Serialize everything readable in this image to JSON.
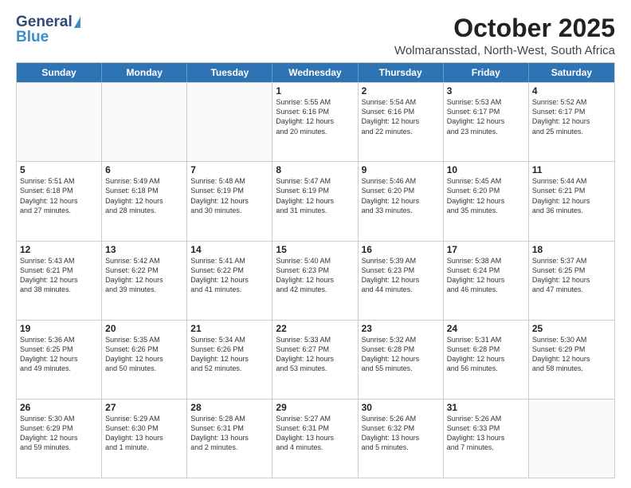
{
  "logo": {
    "line1": "General",
    "line2": "Blue"
  },
  "title": "October 2025",
  "location": "Wolmaransstad, North-West, South Africa",
  "weekdays": [
    "Sunday",
    "Monday",
    "Tuesday",
    "Wednesday",
    "Thursday",
    "Friday",
    "Saturday"
  ],
  "weeks": [
    [
      {
        "day": "",
        "info": ""
      },
      {
        "day": "",
        "info": ""
      },
      {
        "day": "",
        "info": ""
      },
      {
        "day": "1",
        "info": "Sunrise: 5:55 AM\nSunset: 6:16 PM\nDaylight: 12 hours\nand 20 minutes."
      },
      {
        "day": "2",
        "info": "Sunrise: 5:54 AM\nSunset: 6:16 PM\nDaylight: 12 hours\nand 22 minutes."
      },
      {
        "day": "3",
        "info": "Sunrise: 5:53 AM\nSunset: 6:17 PM\nDaylight: 12 hours\nand 23 minutes."
      },
      {
        "day": "4",
        "info": "Sunrise: 5:52 AM\nSunset: 6:17 PM\nDaylight: 12 hours\nand 25 minutes."
      }
    ],
    [
      {
        "day": "5",
        "info": "Sunrise: 5:51 AM\nSunset: 6:18 PM\nDaylight: 12 hours\nand 27 minutes."
      },
      {
        "day": "6",
        "info": "Sunrise: 5:49 AM\nSunset: 6:18 PM\nDaylight: 12 hours\nand 28 minutes."
      },
      {
        "day": "7",
        "info": "Sunrise: 5:48 AM\nSunset: 6:19 PM\nDaylight: 12 hours\nand 30 minutes."
      },
      {
        "day": "8",
        "info": "Sunrise: 5:47 AM\nSunset: 6:19 PM\nDaylight: 12 hours\nand 31 minutes."
      },
      {
        "day": "9",
        "info": "Sunrise: 5:46 AM\nSunset: 6:20 PM\nDaylight: 12 hours\nand 33 minutes."
      },
      {
        "day": "10",
        "info": "Sunrise: 5:45 AM\nSunset: 6:20 PM\nDaylight: 12 hours\nand 35 minutes."
      },
      {
        "day": "11",
        "info": "Sunrise: 5:44 AM\nSunset: 6:21 PM\nDaylight: 12 hours\nand 36 minutes."
      }
    ],
    [
      {
        "day": "12",
        "info": "Sunrise: 5:43 AM\nSunset: 6:21 PM\nDaylight: 12 hours\nand 38 minutes."
      },
      {
        "day": "13",
        "info": "Sunrise: 5:42 AM\nSunset: 6:22 PM\nDaylight: 12 hours\nand 39 minutes."
      },
      {
        "day": "14",
        "info": "Sunrise: 5:41 AM\nSunset: 6:22 PM\nDaylight: 12 hours\nand 41 minutes."
      },
      {
        "day": "15",
        "info": "Sunrise: 5:40 AM\nSunset: 6:23 PM\nDaylight: 12 hours\nand 42 minutes."
      },
      {
        "day": "16",
        "info": "Sunrise: 5:39 AM\nSunset: 6:23 PM\nDaylight: 12 hours\nand 44 minutes."
      },
      {
        "day": "17",
        "info": "Sunrise: 5:38 AM\nSunset: 6:24 PM\nDaylight: 12 hours\nand 46 minutes."
      },
      {
        "day": "18",
        "info": "Sunrise: 5:37 AM\nSunset: 6:25 PM\nDaylight: 12 hours\nand 47 minutes."
      }
    ],
    [
      {
        "day": "19",
        "info": "Sunrise: 5:36 AM\nSunset: 6:25 PM\nDaylight: 12 hours\nand 49 minutes."
      },
      {
        "day": "20",
        "info": "Sunrise: 5:35 AM\nSunset: 6:26 PM\nDaylight: 12 hours\nand 50 minutes."
      },
      {
        "day": "21",
        "info": "Sunrise: 5:34 AM\nSunset: 6:26 PM\nDaylight: 12 hours\nand 52 minutes."
      },
      {
        "day": "22",
        "info": "Sunrise: 5:33 AM\nSunset: 6:27 PM\nDaylight: 12 hours\nand 53 minutes."
      },
      {
        "day": "23",
        "info": "Sunrise: 5:32 AM\nSunset: 6:28 PM\nDaylight: 12 hours\nand 55 minutes."
      },
      {
        "day": "24",
        "info": "Sunrise: 5:31 AM\nSunset: 6:28 PM\nDaylight: 12 hours\nand 56 minutes."
      },
      {
        "day": "25",
        "info": "Sunrise: 5:30 AM\nSunset: 6:29 PM\nDaylight: 12 hours\nand 58 minutes."
      }
    ],
    [
      {
        "day": "26",
        "info": "Sunrise: 5:30 AM\nSunset: 6:29 PM\nDaylight: 12 hours\nand 59 minutes."
      },
      {
        "day": "27",
        "info": "Sunrise: 5:29 AM\nSunset: 6:30 PM\nDaylight: 13 hours\nand 1 minute."
      },
      {
        "day": "28",
        "info": "Sunrise: 5:28 AM\nSunset: 6:31 PM\nDaylight: 13 hours\nand 2 minutes."
      },
      {
        "day": "29",
        "info": "Sunrise: 5:27 AM\nSunset: 6:31 PM\nDaylight: 13 hours\nand 4 minutes."
      },
      {
        "day": "30",
        "info": "Sunrise: 5:26 AM\nSunset: 6:32 PM\nDaylight: 13 hours\nand 5 minutes."
      },
      {
        "day": "31",
        "info": "Sunrise: 5:26 AM\nSunset: 6:33 PM\nDaylight: 13 hours\nand 7 minutes."
      },
      {
        "day": "",
        "info": ""
      }
    ]
  ]
}
